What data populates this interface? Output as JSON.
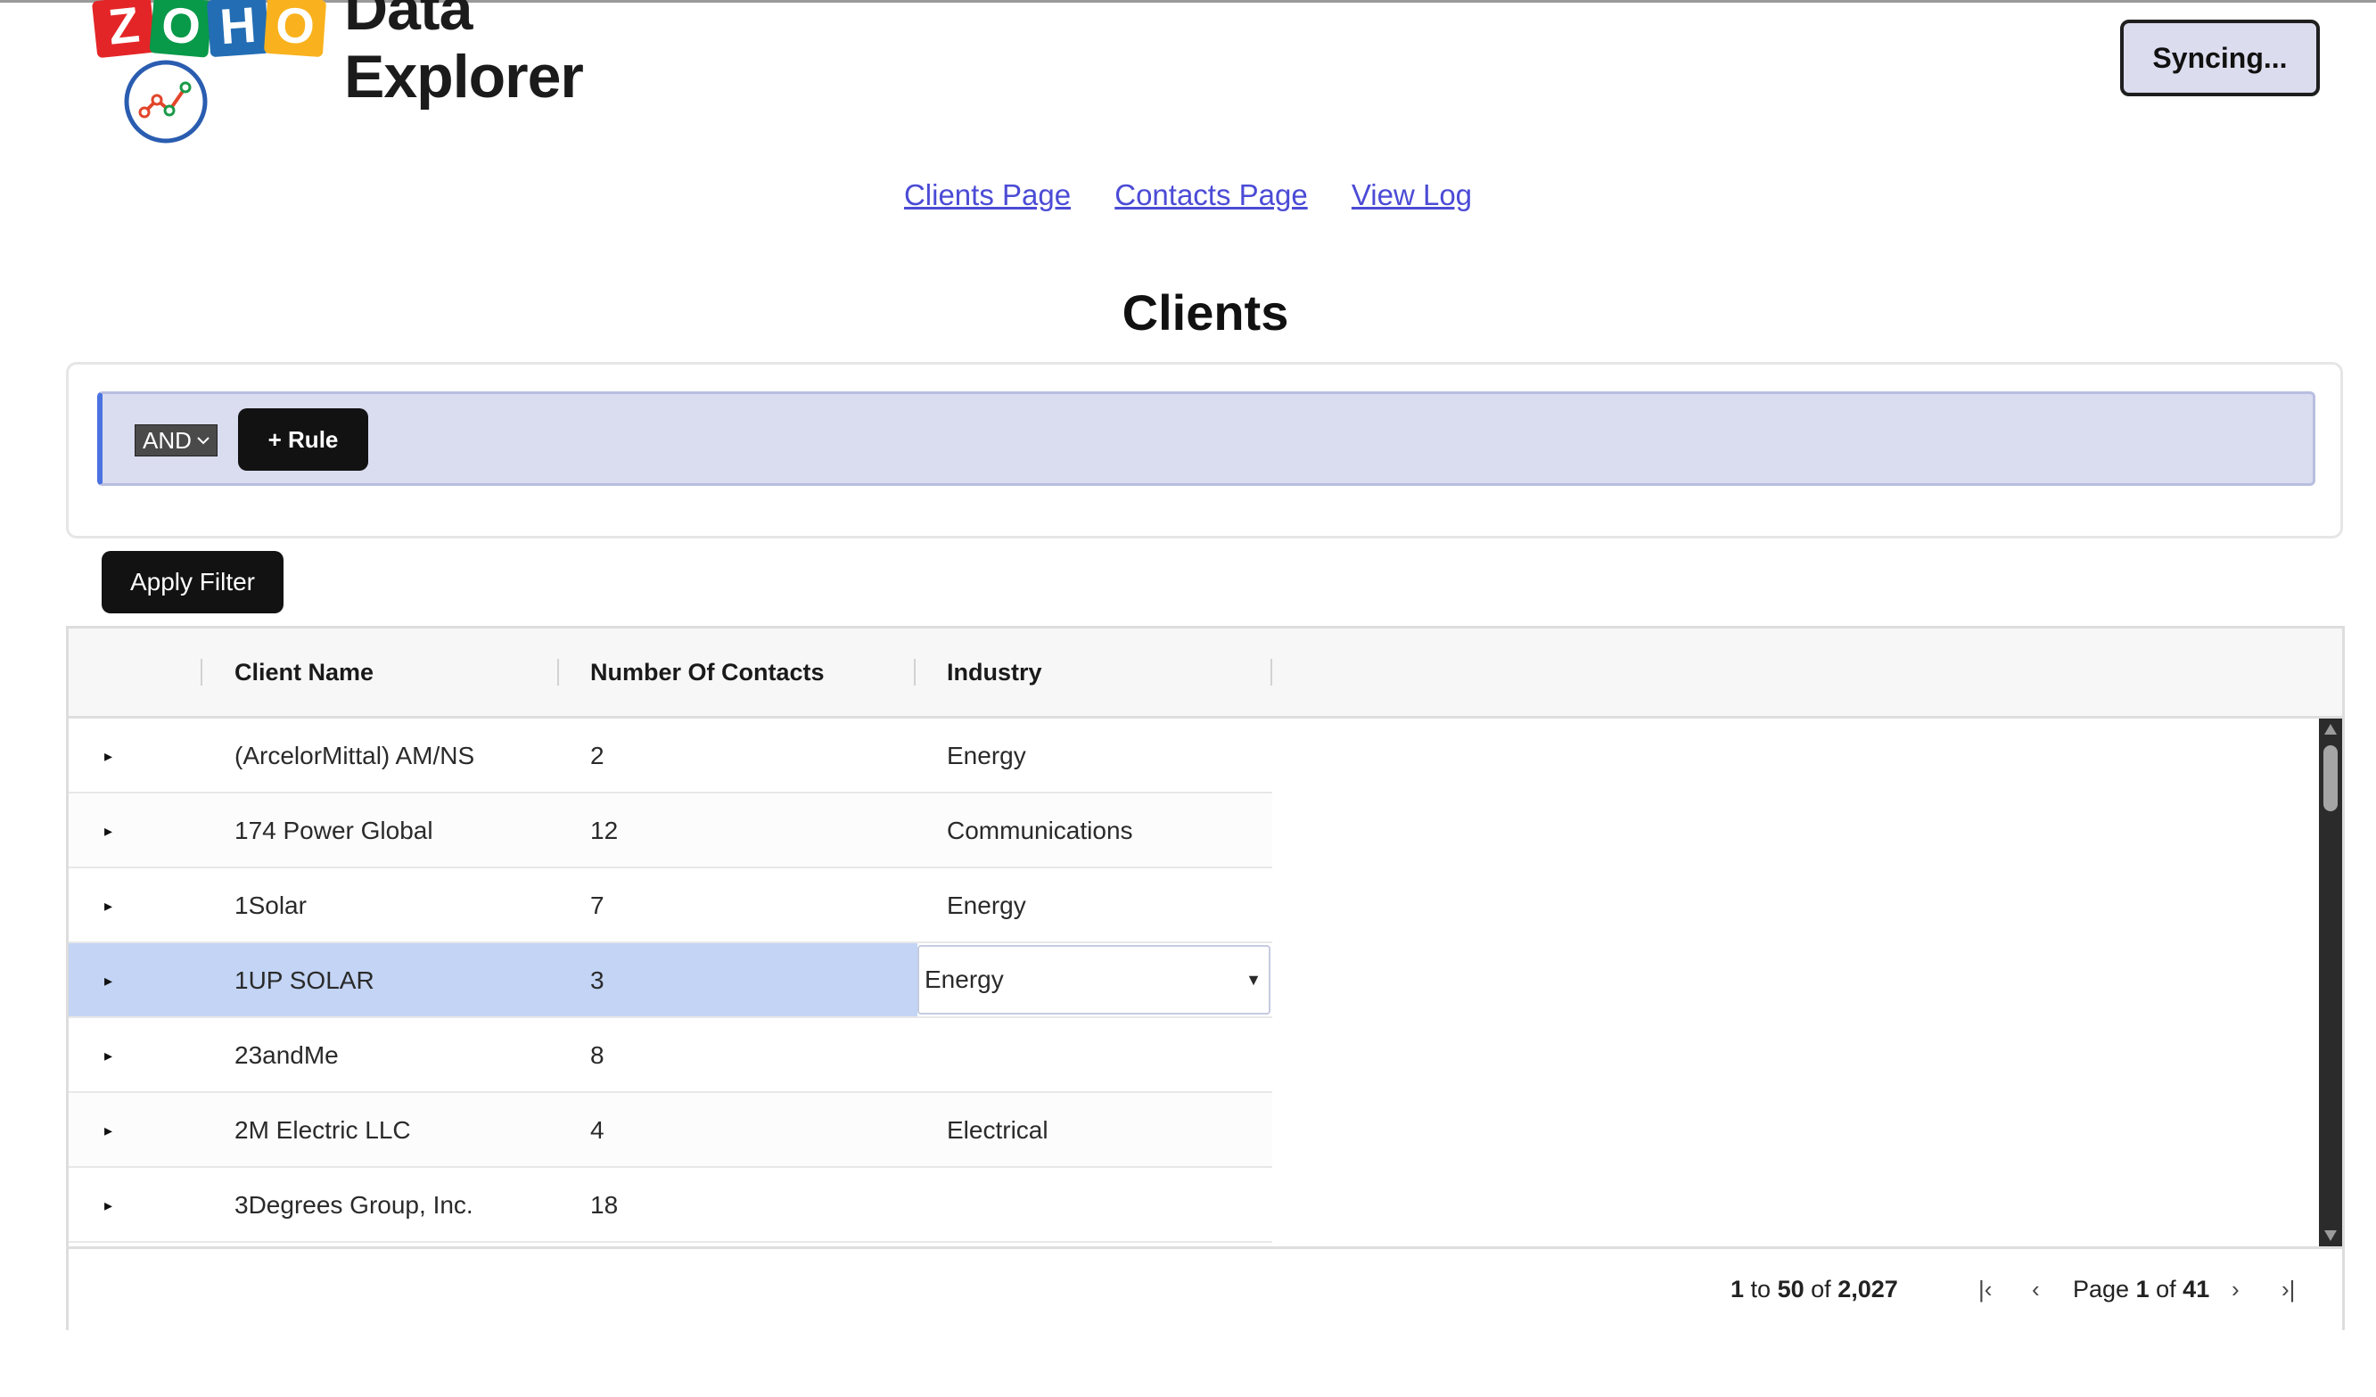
{
  "app": {
    "logo_brand": "ZOHO",
    "logo_title": "Data Explorer",
    "sync_label": "Syncing..."
  },
  "nav": {
    "links": [
      "Clients Page",
      "Contacts Page",
      "View Log"
    ]
  },
  "page_title": "Clients",
  "filter": {
    "combinator": "AND",
    "add_rule_label": "+ Rule",
    "apply_label": "Apply Filter"
  },
  "grid": {
    "columns": [
      "Client Name",
      "Number Of Contacts",
      "Industry"
    ],
    "rows": [
      {
        "expander": "▸",
        "name": "(ArcelorMittal) AM/NS",
        "contacts": "2",
        "industry": "Energy"
      },
      {
        "expander": "▸",
        "name": "174 Power Global",
        "contacts": "12",
        "industry": "Communications"
      },
      {
        "expander": "▸",
        "name": "1Solar",
        "contacts": "7",
        "industry": "Energy"
      },
      {
        "expander": "▸",
        "name": "1UP SOLAR",
        "contacts": "3",
        "industry": "Energy"
      },
      {
        "expander": "▸",
        "name": "23andMe",
        "contacts": "8",
        "industry": ""
      },
      {
        "expander": "▸",
        "name": "2M Electric LLC",
        "contacts": "4",
        "industry": "Electrical"
      },
      {
        "expander": "▸",
        "name": "3Degrees Group, Inc.",
        "contacts": "18",
        "industry": ""
      }
    ],
    "selected_row_index": 3,
    "editor_value": "Energy",
    "pagination": {
      "range_start": "1",
      "range_to": "to",
      "range_end": "50",
      "range_of": "of",
      "total": "2,027",
      "page_label": "Page",
      "page_current": "1",
      "page_of": "of",
      "page_total": "41",
      "first_icon": "first-page-icon",
      "prev_icon": "prev-page-icon",
      "next_icon": "next-page-icon",
      "last_icon": "last-page-icon"
    }
  },
  "colors": {
    "link": "#4b4bd6",
    "selected_row": "#c3d4f5",
    "filter_bg": "#dadcf0",
    "button_dark": "#121212"
  }
}
